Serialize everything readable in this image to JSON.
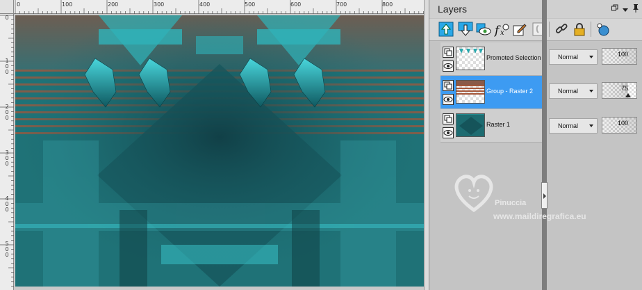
{
  "ruler": {
    "top_ticks": [
      "0",
      "100",
      "200",
      "300",
      "400",
      "500",
      "600",
      "700",
      "800"
    ],
    "left_ticks": [
      "0",
      "100",
      "200",
      "300",
      "400",
      "500"
    ]
  },
  "canvas": {
    "image_colors": {
      "teal": "#2ca6ac",
      "dark_teal": "#154e54",
      "rust": "#a4573a"
    }
  },
  "panel": {
    "title": "Layers",
    "header_controls": [
      "restore-icon",
      "menu-arrow-icon",
      "pin-icon"
    ],
    "toolbar": [
      {
        "name": "move-layer-up-icon"
      },
      {
        "name": "move-layer-down-icon"
      },
      {
        "name": "toggle-visibility-icon"
      },
      {
        "name": "effects-fx-icon"
      },
      {
        "name": "edit-layer-icon"
      },
      {
        "name": "new-layer-icon"
      },
      {
        "name": "link-icon"
      },
      {
        "name": "lock-icon"
      },
      {
        "name": "mask-icon"
      }
    ],
    "layers": [
      {
        "name": "Promoted Selection",
        "blend_mode": "Normal",
        "opacity": "100",
        "selected": false
      },
      {
        "name": "Group - Raster 2",
        "blend_mode": "Normal",
        "opacity": "75",
        "selected": true
      },
      {
        "name": "Raster 1",
        "blend_mode": "Normal",
        "opacity": "100",
        "selected": false
      }
    ],
    "accent_color": "#3d9bf2"
  },
  "watermark": {
    "name": "Pinuccia",
    "site": "www.maildiregrafica.eu"
  }
}
